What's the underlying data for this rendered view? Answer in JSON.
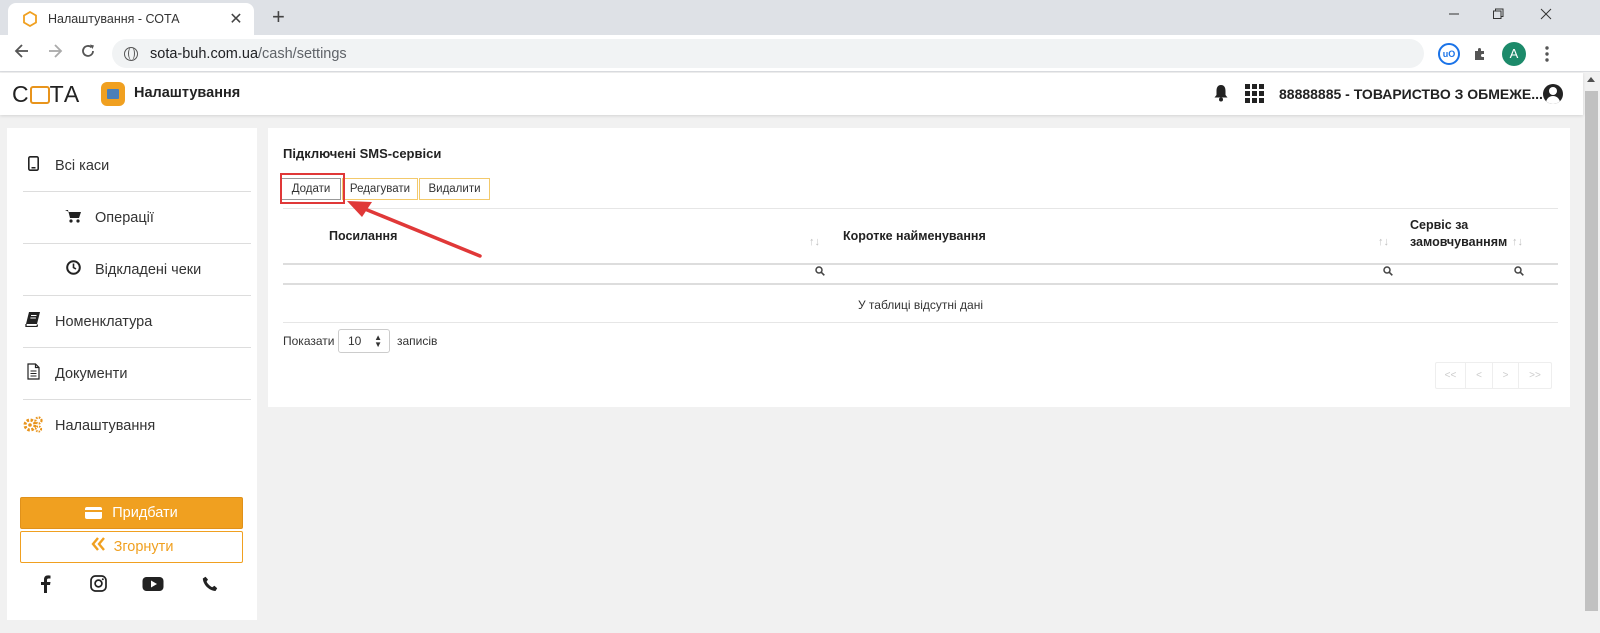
{
  "browser": {
    "tab_title": "Налаштування - СОТА",
    "tab_close": "✕",
    "new_tab": "+",
    "url_domain": "sota-buh.com.ua",
    "url_path": "/cash/settings",
    "avatar_letter": "A",
    "ublock_label": "uO"
  },
  "header": {
    "logo_left": "С",
    "logo_right": "ТА",
    "title": "Налаштування",
    "company": "88888885 - ТОВАРИСТВО З ОБМЕЖЕ..."
  },
  "sidebar": {
    "items": [
      {
        "label": "Всі каси",
        "icon": "tablet-icon"
      },
      {
        "label": "Операції",
        "icon": "cart-icon"
      },
      {
        "label": "Відкладені чеки",
        "icon": "clock-icon"
      },
      {
        "label": "Номенклатура",
        "icon": "book-icon"
      },
      {
        "label": "Документи",
        "icon": "document-icon"
      },
      {
        "label": "Налаштування",
        "icon": "gears-icon"
      }
    ],
    "buy_label": "Придбати",
    "collapse_label": "Згорнути",
    "social": [
      "facebook-icon",
      "instagram-icon",
      "youtube-icon",
      "phone-icon"
    ]
  },
  "main": {
    "title": "Підключені SMS-сервіси",
    "toolbar": {
      "add": "Додати",
      "edit": "Редагувати",
      "delete": "Видалити"
    },
    "columns": [
      "Посилання",
      "Коротке найменування",
      "Сервіс за замовчуванням"
    ],
    "empty_message": "У таблиці відсутні дані",
    "length": {
      "prefix": "Показати",
      "value": "10",
      "suffix": "записів"
    },
    "pager": {
      "first": "<<",
      "prev": "<",
      "next": ">",
      "last": ">>"
    }
  },
  "colors": {
    "accent": "#f0a020",
    "highlight": "#e03838"
  }
}
